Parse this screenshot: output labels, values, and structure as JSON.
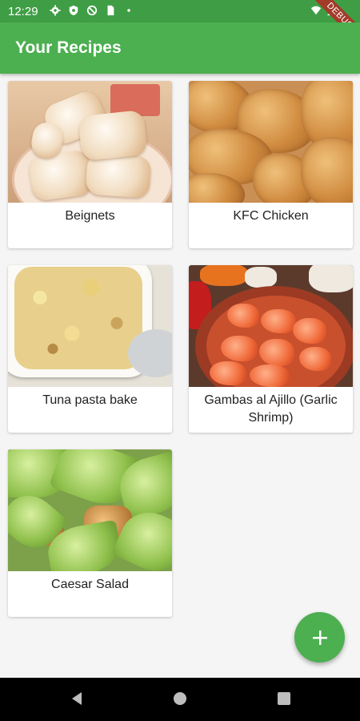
{
  "status_bar": {
    "time": "12:29",
    "icons_left": [
      "settings-icon",
      "shield-icon",
      "no-disturb-icon",
      "sim-card-icon",
      "dot-icon"
    ],
    "icons_right": [
      "wifi-icon",
      "signal-icon"
    ],
    "debug_banner": "DEBUG"
  },
  "app_bar": {
    "title": "Your Recipes"
  },
  "recipes": [
    {
      "name": "Beignets",
      "image": "beignets-photo"
    },
    {
      "name": "KFC Chicken",
      "image": "fried-chicken-photo"
    },
    {
      "name": "Tuna pasta bake",
      "image": "tuna-pasta-bake-photo"
    },
    {
      "name": "Gambas al Ajillo (Garlic Shrimp)",
      "image": "garlic-shrimp-photo"
    },
    {
      "name": "Caesar Salad",
      "image": "caesar-salad-photo"
    }
  ],
  "fab": {
    "icon": "plus-icon",
    "color": "#4caf50"
  },
  "nav_bar": {
    "buttons": [
      "back-icon",
      "home-icon",
      "recents-icon"
    ]
  },
  "colors": {
    "primary": "#4caf50",
    "status_bar": "#3f9e45",
    "background": "#f5f5f5"
  }
}
